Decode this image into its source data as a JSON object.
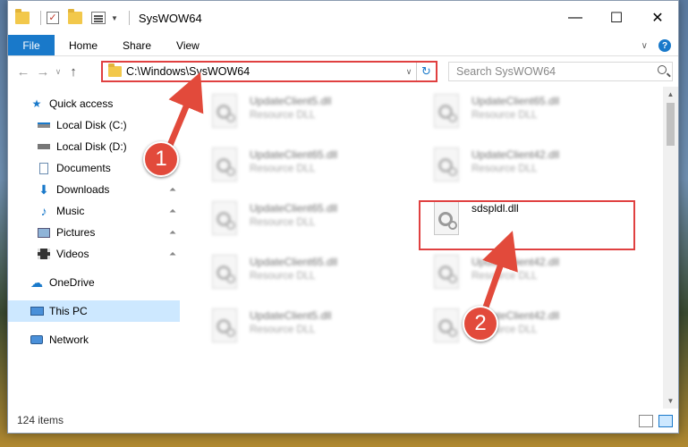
{
  "window": {
    "title": "SysWOW64"
  },
  "ribbon": {
    "file": "File",
    "tabs": [
      "Home",
      "Share",
      "View"
    ],
    "help": "?"
  },
  "address": {
    "path": "C:\\Windows\\SysWOW64"
  },
  "search": {
    "placeholder": "Search SysWOW64"
  },
  "sidebar": {
    "items": [
      {
        "label": "Quick access",
        "icon": "star-icon"
      },
      {
        "label": "Local Disk (C:)",
        "icon": "drive-icon"
      },
      {
        "label": "Local Disk (D:)",
        "icon": "drive-icon"
      },
      {
        "label": "Documents",
        "icon": "documents-icon"
      },
      {
        "label": "Downloads",
        "icon": "downloads-icon"
      },
      {
        "label": "Music",
        "icon": "music-icon"
      },
      {
        "label": "Pictures",
        "icon": "pictures-icon"
      },
      {
        "label": "Videos",
        "icon": "videos-icon"
      },
      {
        "label": "OneDrive",
        "icon": "cloud-icon"
      },
      {
        "label": "This PC",
        "icon": "computer-icon"
      },
      {
        "label": "Network",
        "icon": "network-icon"
      }
    ]
  },
  "files": [
    {
      "name": "UpdateClient5.dll",
      "type": "Resource DLL"
    },
    {
      "name": "UpdateClient65.dll",
      "type": "Resource DLL"
    },
    {
      "name": "UpdateClient65.dll",
      "type": "Resource DLL"
    },
    {
      "name": "UpdateClient42.dll",
      "type": "Resource DLL"
    },
    {
      "name": "UpdateClient65.dll",
      "type": "Resource DLL"
    },
    {
      "name": "sdspldl.dll",
      "type": ""
    },
    {
      "name": "UpdateClient65.dll",
      "type": "Resource DLL"
    },
    {
      "name": "UpdateClient42.dll",
      "type": "Resource DLL"
    },
    {
      "name": "UpdateClient5.dll",
      "type": "Resource DLL"
    },
    {
      "name": "UpdateClient42.dll",
      "type": "Resource DLL"
    }
  ],
  "status": {
    "count": "124 items"
  },
  "annotations": {
    "step1": "1",
    "step2": "2"
  },
  "colors": {
    "accent": "#1979ca",
    "highlight": "#e04040",
    "annotation": "#e24a3b"
  }
}
